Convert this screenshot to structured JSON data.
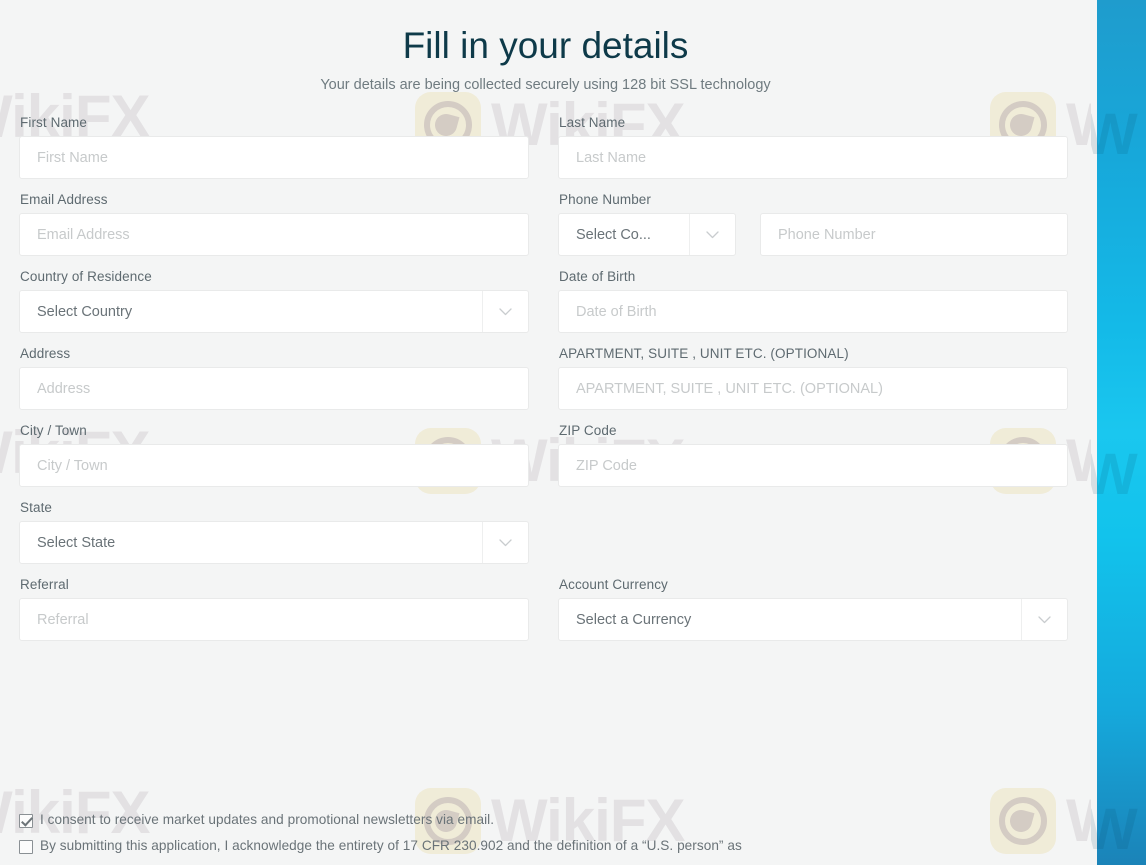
{
  "header": {
    "title": "Fill in your details",
    "subtitle": "Your details are being collected securely using 128 bit SSL technology"
  },
  "watermark": {
    "text": "WikiFX"
  },
  "form": {
    "first_name": {
      "label": "First Name",
      "placeholder": "First Name",
      "value": ""
    },
    "last_name": {
      "label": "Last Name",
      "placeholder": "Last Name",
      "value": ""
    },
    "email": {
      "label": "Email Address",
      "placeholder": "Email Address",
      "value": ""
    },
    "phone": {
      "label": "Phone Number",
      "country_code_value": "Select Co...",
      "number_placeholder": "Phone Number",
      "number_value": ""
    },
    "country": {
      "label": "Country of Residence",
      "value": "Select Country"
    },
    "dob": {
      "label": "Date of Birth",
      "placeholder": "Date of Birth",
      "value": ""
    },
    "address": {
      "label": "Address",
      "placeholder": "Address",
      "value": ""
    },
    "apartment": {
      "label": "APARTMENT, SUITE , UNIT ETC. (OPTIONAL)",
      "placeholder": "APARTMENT, SUITE , UNIT ETC. (OPTIONAL)",
      "value": ""
    },
    "city": {
      "label": "City / Town",
      "placeholder": "City / Town",
      "value": ""
    },
    "zip": {
      "label": "ZIP Code",
      "placeholder": "ZIP Code",
      "value": ""
    },
    "state": {
      "label": "State",
      "value": "Select State"
    },
    "referral": {
      "label": "Referral",
      "placeholder": "Referral",
      "value": ""
    },
    "currency": {
      "label": "Account Currency",
      "value": "Select a Currency"
    }
  },
  "agreements": [
    {
      "checked": true,
      "text": "I consent to receive market updates and promotional newsletters via email."
    },
    {
      "checked": false,
      "text": "By submitting this application, I acknowledge the entirety of 17 CFR 230.902 and the definition of a “U.S. person” as"
    }
  ],
  "colors": {
    "title": "#0e3a49",
    "label": "#5e6a70",
    "placeholder": "#c7cacb",
    "value": "#6a7378",
    "background": "#f4f5f5",
    "field_background": "#ffffff",
    "field_border": "#e9eaea",
    "rail_top": "#1f9ccd",
    "rail_mid": "#1ac7ef",
    "rail_bottom": "#1b83b8"
  }
}
